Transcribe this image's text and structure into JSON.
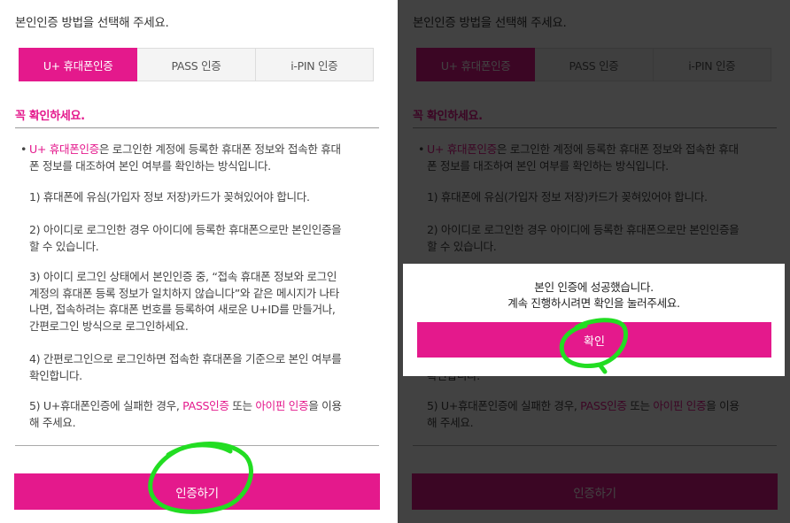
{
  "header": {
    "instruction": "본인인증 방법을 선택해 주세요."
  },
  "tabs": [
    {
      "label": "U+ 휴대폰인증",
      "active": true
    },
    {
      "label": "PASS 인증",
      "active": false
    },
    {
      "label": "i-PIN 인증",
      "active": false
    }
  ],
  "notice": {
    "title": "꼭 확인하세요.",
    "bullet_symbol": "•",
    "intro_highlight": "U+ 휴대폰인증",
    "intro_line1_rest": "은 로그인한 계정에 등록한 휴대폰 정보와 접속한 휴대",
    "intro_line2": "폰 정보를 대조하여 본인 여부를 확인하는 방식입니다.",
    "item1": "1) 휴대폰에 유심(가입자 정보 저장)카드가 꽂혀있어야 합니다.",
    "item2_line1": "2) 아이디로 로그인한 경우 아이디에 등록한 휴대폰으로만 본인인증을",
    "item2_line2": "할 수 있습니다.",
    "item3_line1": "3) 아이디 로그인 상태에서 본인인증 중, “접속 휴대폰 정보와 로그인",
    "item3_line2": "계정의 휴대폰 등록 정보가 일치하지 않습니다”와 같은 메시지가 나타",
    "item3_line3": "나면, 접속하려는 휴대폰 번호를 등록하여 새로운 U+ID를 만들거나,",
    "item3_line4": "간편로그인 방식으로 로그인하세요.",
    "item4_line1": "4) 간편로그인으로 로그인하면 접속한 휴대폰을 기준으로 본인 여부를",
    "item4_line2": "확인합니다.",
    "item5_prefix": "5) U+휴대폰인증에 실패한 경우, ",
    "item5_link1": "PASS인증",
    "item5_mid": " 또는 ",
    "item5_link2": "아이핀 인증",
    "item5_suffix": "을 이용",
    "item5_line2": "해 주세요."
  },
  "cta": {
    "label": "인증하기"
  },
  "dialog": {
    "message_line1": "본인 인증에 성공했습니다.",
    "message_line2": "계속 진행하시려면 확인을 눌러주세요.",
    "confirm_label": "확인"
  },
  "colors": {
    "accent": "#e4198c",
    "annotation": "#22dd22"
  }
}
